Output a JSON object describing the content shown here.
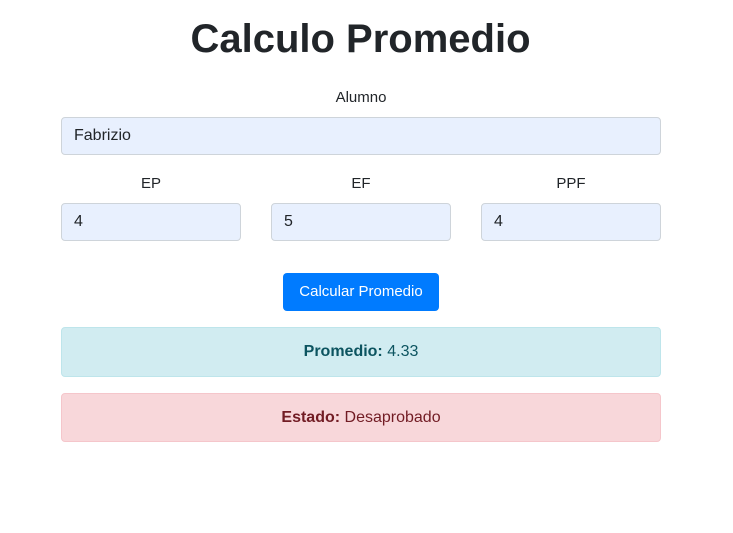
{
  "title": "Calculo Promedio",
  "form": {
    "alumno": {
      "label": "Alumno",
      "value": "Fabrizio"
    },
    "ep": {
      "label": "EP",
      "value": "4"
    },
    "ef": {
      "label": "EF",
      "value": "5"
    },
    "ppf": {
      "label": "PPF",
      "value": "4"
    },
    "submit_label": "Calcular Promedio"
  },
  "results": {
    "promedio": {
      "label": "Promedio:",
      "value": "4.33"
    },
    "estado": {
      "label": "Estado:",
      "value": "Desaprobado"
    }
  },
  "colors": {
    "primary": "#007bff",
    "info_bg": "#d1ecf1",
    "info_text": "#0c5460",
    "danger_bg": "#f8d7da",
    "danger_text": "#721c24",
    "input_bg": "#e8f0fe"
  }
}
